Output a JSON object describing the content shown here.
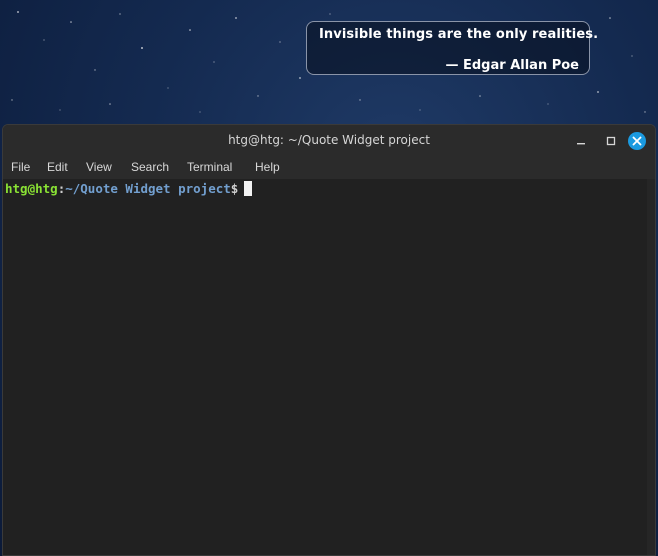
{
  "desktop": {
    "quote_widget": {
      "text": "Invisible things are the only realities.",
      "author": "— Edgar Allan Poe"
    }
  },
  "terminal": {
    "title": "htg@htg: ~/Quote Widget project",
    "menu": [
      "File",
      "Edit",
      "View",
      "Search",
      "Terminal",
      "Help"
    ],
    "prompt": {
      "user_host": "htg@htg",
      "colon": ":",
      "path": "~/Quote Widget project",
      "dollar": "$"
    },
    "buttons": {
      "minimize_icon": "minimize-icon",
      "maximize_icon": "maximize-icon",
      "close_icon": "close-icon"
    },
    "colors": {
      "prompt_user": "#8ae234",
      "prompt_path": "#729fcf",
      "close_button": "#1b9ae0",
      "background": "#212121"
    }
  }
}
